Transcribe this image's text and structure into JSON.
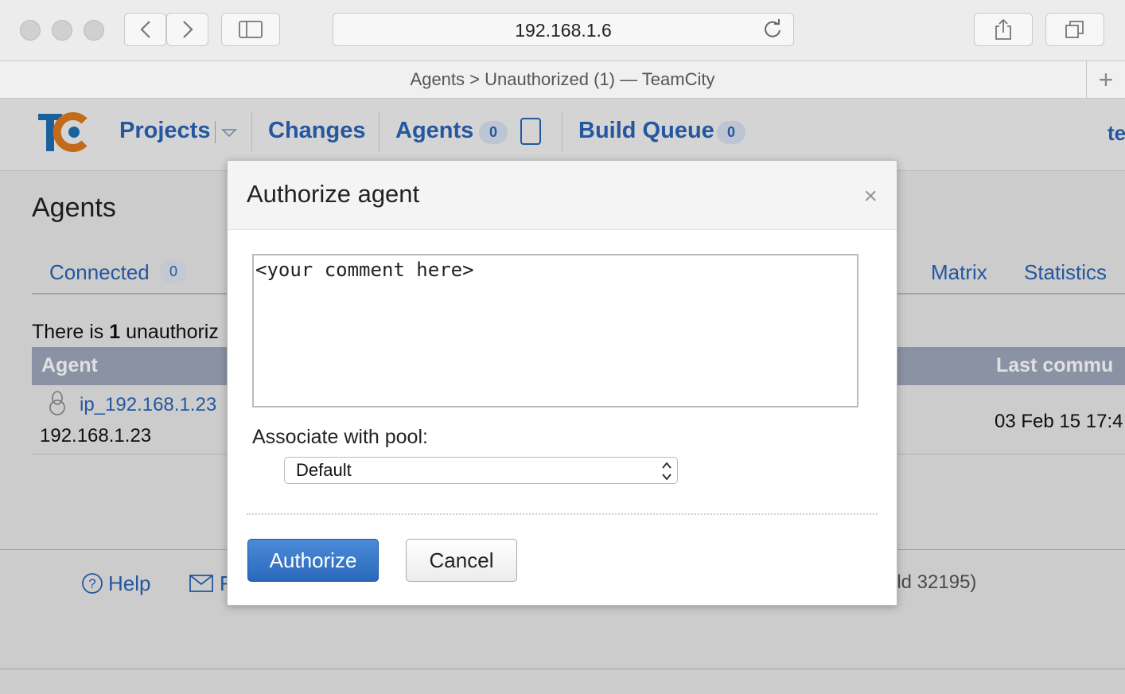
{
  "browser": {
    "url": "192.168.1.6",
    "tab_title": "Agents > Unauthorized (1) — TeamCity",
    "new_tab": "+"
  },
  "nav": {
    "projects": "Projects",
    "changes": "Changes",
    "agents": "Agents",
    "agents_count": "0",
    "build_queue": "Build Queue",
    "build_queue_count": "0",
    "user_partial": "te"
  },
  "page": {
    "title": "Agents",
    "tabs": {
      "connected": "Connected",
      "connected_count": "0",
      "matrix": "Matrix",
      "statistics": "Statistics"
    },
    "summary": {
      "prefix": "There is ",
      "count": "1",
      "suffix": " unauthoriz"
    },
    "table": {
      "col_agent": "Agent",
      "col_last": "Last commu",
      "row": {
        "name": "ip_192.168.1.23",
        "ip": "192.168.1.23",
        "last": "03 Feb 15 17:4"
      }
    },
    "footer": {
      "help": "Help",
      "feedback_partial": "F",
      "build_partial": "ild 32195)"
    }
  },
  "dialog": {
    "title": "Authorize agent",
    "close": "×",
    "comment_value": "<your comment here>",
    "pool_label": "Associate with pool:",
    "pool_selected": "Default",
    "authorize": "Authorize",
    "cancel": "Cancel"
  },
  "colors": {
    "link": "#2a64b7",
    "primary_button": "#2f6fc3",
    "table_header": "#9ea7bb"
  }
}
